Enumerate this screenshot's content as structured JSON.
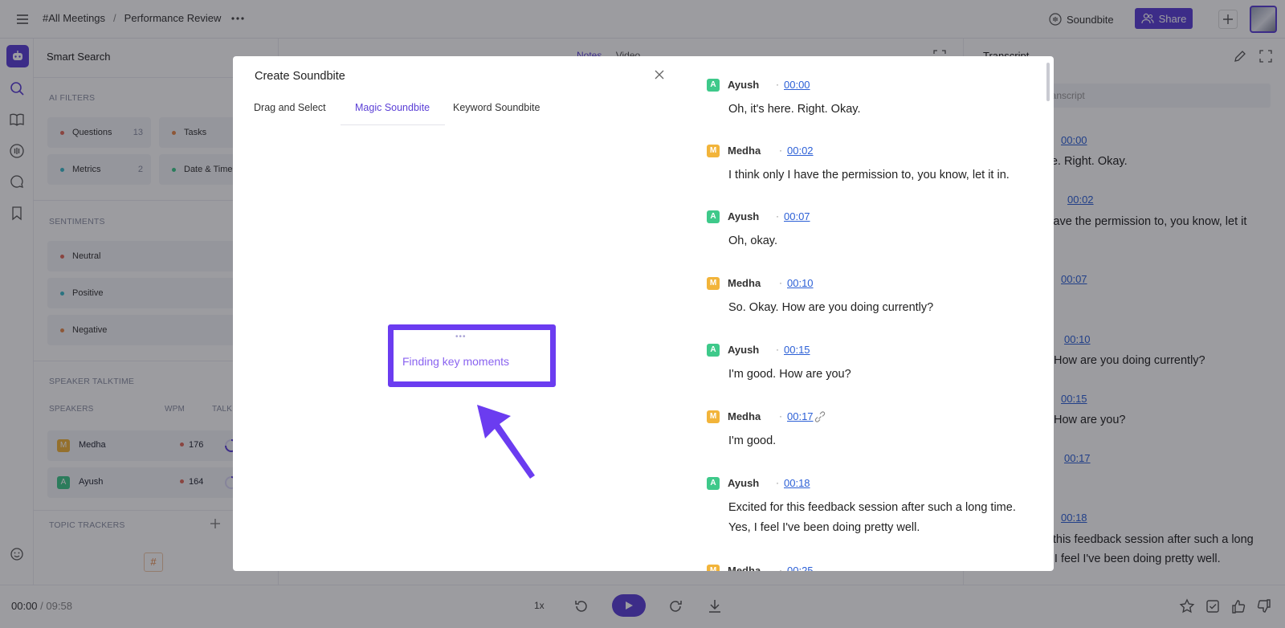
{
  "header": {
    "breadcrumb": [
      "#All Meetings",
      "Performance Review"
    ],
    "breadcrumb_sep": "/",
    "soundbite_label": "Soundbite",
    "share_label": "Share"
  },
  "left": {
    "smart_search": "Smart Search",
    "ai_filters_label": "AI FILTERS",
    "filters": [
      {
        "label": "Questions",
        "count": "13",
        "color": "#e06a5a"
      },
      {
        "label": "Tasks",
        "count": "",
        "color": "#e6894a"
      },
      {
        "label": "Metrics",
        "count": "2",
        "color": "#3cb8c9"
      },
      {
        "label": "Date & Time",
        "count": "",
        "color": "#3cc98a"
      }
    ],
    "sentiments_label": "SENTIMENTS",
    "sentiments": [
      {
        "label": "Neutral",
        "color": "#e06a5a"
      },
      {
        "label": "Positive",
        "color": "#3cb8c9"
      },
      {
        "label": "Negative",
        "color": "#e6894a"
      }
    ],
    "talktime_label": "SPEAKER TALKTIME",
    "speakers_header": {
      "speakers": "SPEAKERS",
      "wpm": "WPM",
      "talk": "TALK"
    },
    "speakers": [
      {
        "initial": "M",
        "name": "Medha",
        "wpm": "176",
        "color": "#f2b43a"
      },
      {
        "initial": "A",
        "name": "Ayush",
        "wpm": "164",
        "color": "#3ec98a"
      }
    ],
    "topic_trackers_label": "TOPIC TRACKERS",
    "hash": "#"
  },
  "center": {
    "tab_notes": "Notes",
    "tab_video": "Video"
  },
  "transcript_panel": {
    "title": "Transcript",
    "search_placeholder": "Search transcript",
    "entries": [
      {
        "time": "00:00",
        "text": "re. Right. Okay."
      },
      {
        "time": "00:02",
        "text": "y I have the permission to, you know, let it"
      },
      {
        "time": "00:07",
        "text": ""
      },
      {
        "time": "00:10",
        "text": "How are you doing currently?"
      },
      {
        "time": "00:15",
        "text": "How are you?"
      },
      {
        "time": "00:17",
        "text": ""
      },
      {
        "time": "00:18",
        "text": "r this feedback session after such a long"
      },
      {
        "time": "",
        "text": "time. Yes, I feel I've been doing pretty well."
      }
    ]
  },
  "player": {
    "current": "00:00",
    "sep": "/",
    "total": "09:58",
    "speed": "1x"
  },
  "modal": {
    "title": "Create Soundbite",
    "tabs": [
      "Drag and Select",
      "Magic Soundbite",
      "Keyword Soundbite"
    ],
    "active_tab": 1,
    "status_dots": "•••",
    "status_text": "Finding key moments",
    "transcript": [
      {
        "initial": "A",
        "name": "Ayush",
        "time": "00:00",
        "color": "#3ec98a",
        "text": "Oh, it's here. Right. Okay."
      },
      {
        "initial": "M",
        "name": "Medha",
        "time": "00:02",
        "color": "#f2b43a",
        "text": "I think only I have the permission to, you know, let it in."
      },
      {
        "initial": "A",
        "name": "Ayush",
        "time": "00:07",
        "color": "#3ec98a",
        "text": "Oh, okay."
      },
      {
        "initial": "M",
        "name": "Medha",
        "time": "00:10",
        "color": "#f2b43a",
        "text": "So. Okay. How are you doing currently?"
      },
      {
        "initial": "A",
        "name": "Ayush",
        "time": "00:15",
        "color": "#3ec98a",
        "text": "I'm good. How are you?"
      },
      {
        "initial": "M",
        "name": "Medha",
        "time": "00:17",
        "color": "#f2b43a",
        "text": "I'm good."
      },
      {
        "initial": "A",
        "name": "Ayush",
        "time": "00:18",
        "color": "#3ec98a",
        "text": "Excited for this feedback session after such a long time. Yes, I feel I've been doing pretty well."
      },
      {
        "initial": "M",
        "name": "Medha",
        "time": "00:25",
        "color": "#f2b43a",
        "text": ""
      }
    ]
  },
  "colors": {
    "accent": "#5b3fd6",
    "highlight": "#6b3cf0",
    "link": "#2b5fd6"
  }
}
